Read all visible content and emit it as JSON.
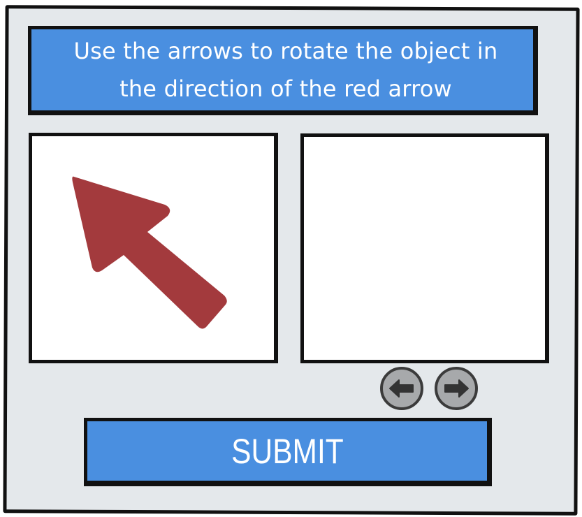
{
  "instruction": {
    "text": "Use the arrows to rotate the object in the direction of the red arrow"
  },
  "target_panel": {
    "object": "red-arrow-icon",
    "object_color": "#a33a3d"
  },
  "workspace_panel": {},
  "controls": {
    "rotate_left": "arrow-left-icon",
    "rotate_right": "arrow-right-icon"
  },
  "submit": {
    "label": "SUBMIT"
  },
  "colors": {
    "accent": "#4a8fe0",
    "background": "#e4e8eb",
    "button_gray": "#a7a9ab",
    "arrow_red": "#a33a3d"
  }
}
